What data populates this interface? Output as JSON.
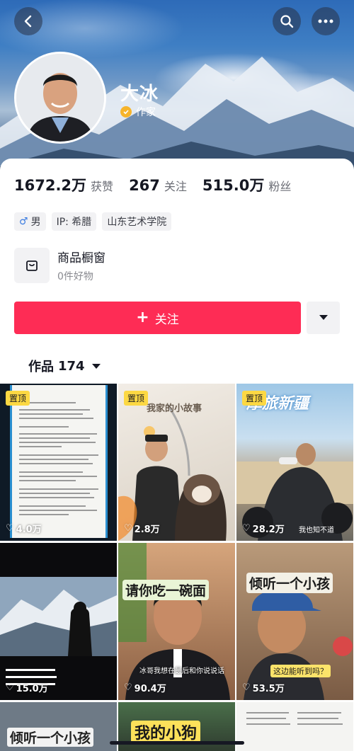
{
  "profile": {
    "name": "大冰",
    "verified_label": "作家"
  },
  "stats": [
    {
      "value": "1672.2万",
      "label": "获赞"
    },
    {
      "value": "267",
      "label": "关注"
    },
    {
      "value": "515.0万",
      "label": "粉丝"
    }
  ],
  "tags": {
    "gender": "男",
    "gender_icon": "male-icon",
    "ip": "IP: 希腊",
    "school": "山东艺术学院"
  },
  "shop": {
    "title": "商品橱窗",
    "subtitle": "0件好物"
  },
  "actions": {
    "follow_label": "关注"
  },
  "works": {
    "label": "作品",
    "count": "174"
  },
  "videos": [
    {
      "pinned": "置顶",
      "likes": "4.0万",
      "caption": ""
    },
    {
      "pinned": "置顶",
      "likes": "2.8万",
      "caption": "我家的小故事"
    },
    {
      "pinned": "置顶",
      "likes": "28.2万",
      "caption": "摩旅新疆",
      "meta": "我也知不道"
    },
    {
      "pinned": "",
      "likes": "15.0万",
      "caption": ""
    },
    {
      "pinned": "",
      "likes": "90.4万",
      "caption": "请你吃一碗面",
      "subtitle": "冰哥我想在最后和你说说话"
    },
    {
      "pinned": "",
      "likes": "53.5万",
      "caption": "倾听一个小孩",
      "subtitle": "这边能听到吗？"
    },
    {
      "pinned": "",
      "likes": "",
      "caption": "倾听一个小孩"
    },
    {
      "pinned": "",
      "likes": "",
      "caption": "我的小狗"
    },
    {
      "pinned": "",
      "likes": "",
      "caption": ""
    }
  ],
  "colors": {
    "accent": "#fe2c55",
    "pin": "#fcd843",
    "verify": "#f6b42b"
  }
}
